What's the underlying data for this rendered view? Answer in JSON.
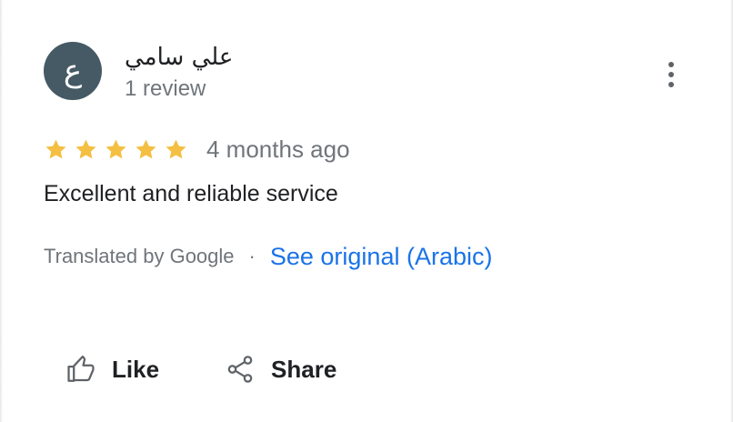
{
  "review": {
    "avatar_initial": "ع",
    "author_name": "علي سامي",
    "review_count": "1 review",
    "rating": 5,
    "rating_max": 5,
    "timestamp": "4 months ago",
    "text": "Excellent and reliable service",
    "translated_by": "Translated by Google",
    "separator": "·",
    "see_original": "See original (Arabic)"
  },
  "actions": {
    "like_label": "Like",
    "share_label": "Share"
  },
  "icons": {
    "more": "more-vert-icon",
    "star": "star-icon",
    "like": "thumb-up-icon",
    "share": "share-icon"
  },
  "colors": {
    "avatar_bg": "#455a64",
    "star": "#f4bf42",
    "link": "#1a73e8",
    "muted": "#70757a",
    "text": "#202124"
  }
}
